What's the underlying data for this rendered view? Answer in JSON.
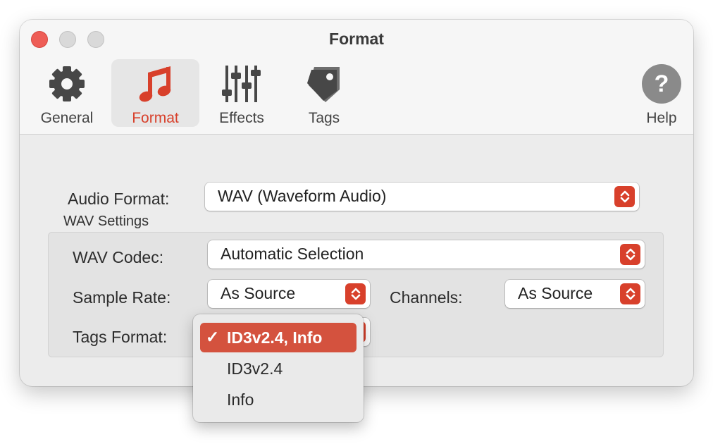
{
  "window": {
    "title": "Format"
  },
  "toolbar": {
    "items": [
      {
        "label": "General",
        "icon": "gear-icon"
      },
      {
        "label": "Format",
        "icon": "music-note-icon",
        "selected": true
      },
      {
        "label": "Effects",
        "icon": "sliders-icon"
      },
      {
        "label": "Tags",
        "icon": "tag-icon"
      },
      {
        "label": "Help",
        "icon": "help-icon"
      }
    ]
  },
  "audio_format": {
    "label": "Audio Format:",
    "value": "WAV (Waveform Audio)"
  },
  "wav_settings": {
    "title": "WAV Settings",
    "codec": {
      "label": "WAV Codec:",
      "value": "Automatic Selection"
    },
    "sample_rate": {
      "label": "Sample Rate:",
      "value": "As Source"
    },
    "channels": {
      "label": "Channels:",
      "value": "As Source"
    },
    "tags_format": {
      "label": "Tags Format:",
      "selected": "ID3v2.4, Info",
      "options": [
        "ID3v2.4, Info",
        "ID3v2.4",
        "Info"
      ],
      "check_mark": "✓"
    }
  },
  "colors": {
    "accent": "#d8402b",
    "menu_highlight": "#d4523e",
    "close_button": "#ee5d56"
  }
}
